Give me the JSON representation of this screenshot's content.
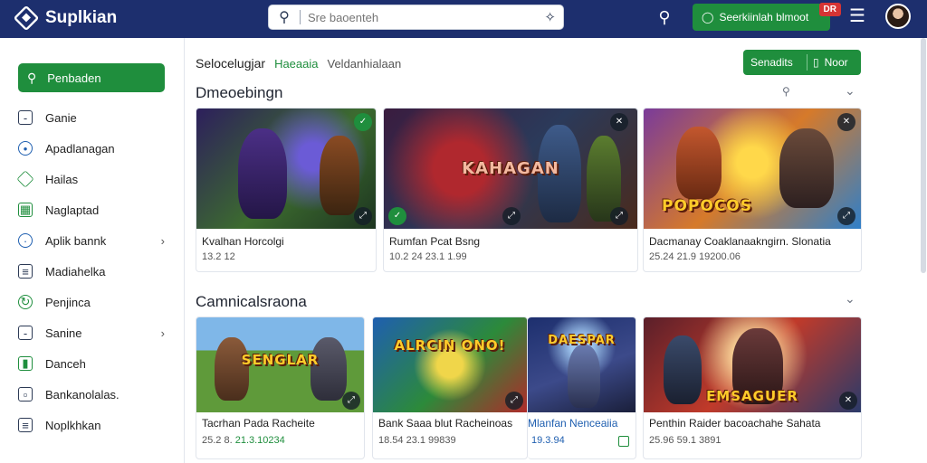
{
  "app": {
    "name": "Suplkian",
    "logo_icon": "diamond-logo-icon"
  },
  "header": {
    "search_placeholder": "Sre baoenteh",
    "cta_label": "Seerkiinlah blmoot",
    "cta_badge": "DR",
    "colors": {
      "bar": "#1d2f6e",
      "accent": "#1f8e3d",
      "badge": "#d63434"
    }
  },
  "sidebar": {
    "primary_label": "Penbaden",
    "items": [
      {
        "label": "Ganie",
        "icon": "square-icon"
      },
      {
        "label": "Apadlanagan",
        "icon": "drop-icon"
      },
      {
        "label": "Hailas",
        "icon": "diamond-icon"
      },
      {
        "label": "Naglaptad",
        "icon": "grid-icon"
      },
      {
        "label": "Aplik bannk",
        "icon": "compass-icon",
        "has_chevron": true
      },
      {
        "label": "Madiahelka",
        "icon": "doc-icon"
      },
      {
        "label": "Penjinca",
        "icon": "refresh-icon"
      },
      {
        "label": "Sanine",
        "icon": "list-icon",
        "has_chevron": true
      },
      {
        "label": "Danceh",
        "icon": "clipboard-icon"
      },
      {
        "label": "Bankanolalas.",
        "icon": "box-icon"
      },
      {
        "label": "Noplkhkan",
        "icon": "file-icon"
      }
    ]
  },
  "main": {
    "tabs": [
      {
        "label": "Selocelugjar",
        "state": "default"
      },
      {
        "label": "Haeaaia",
        "state": "active"
      },
      {
        "label": "Veldanhialaan",
        "state": "muted"
      }
    ],
    "actions": {
      "primary": "Senadits",
      "secondary": "Noor"
    },
    "sections": [
      {
        "title": "Dmeoebingn",
        "cards": [
          {
            "title": "Kvalhan Horcolgi",
            "meta": "13.2 12",
            "art_title": ""
          },
          {
            "title": "Rumfan Pcat Bsng",
            "meta": "10.2 24   23.1 1.99",
            "art_title": "KAHAGAN"
          },
          {
            "title": "Dacmanay Coaklanaakngirn. Slonatia",
            "meta": "25.24   21.9 19200.06",
            "art_title": "POPOCOS"
          }
        ]
      },
      {
        "title": "Camnicalsraona",
        "cards": [
          {
            "title": "Tacrhan Pada Racheite",
            "meta": "25.2 8.",
            "meta_accent": "21.3.10234",
            "art_title": "SENGLAR"
          },
          {
            "title": "Bank Saaa blut Racheinoas",
            "meta": "18.54   23.1 99839",
            "art_title": "ALRCIN ONO!"
          },
          {
            "title": "Mlanfan Nenceaiia",
            "meta": "19.3.94",
            "art_title": "DAESPAR"
          },
          {
            "title": "Penthin Raider bacoachahe Sahata",
            "meta": "25.96   59.1 3891",
            "art_title": "EMSAGUER"
          }
        ]
      }
    ]
  }
}
